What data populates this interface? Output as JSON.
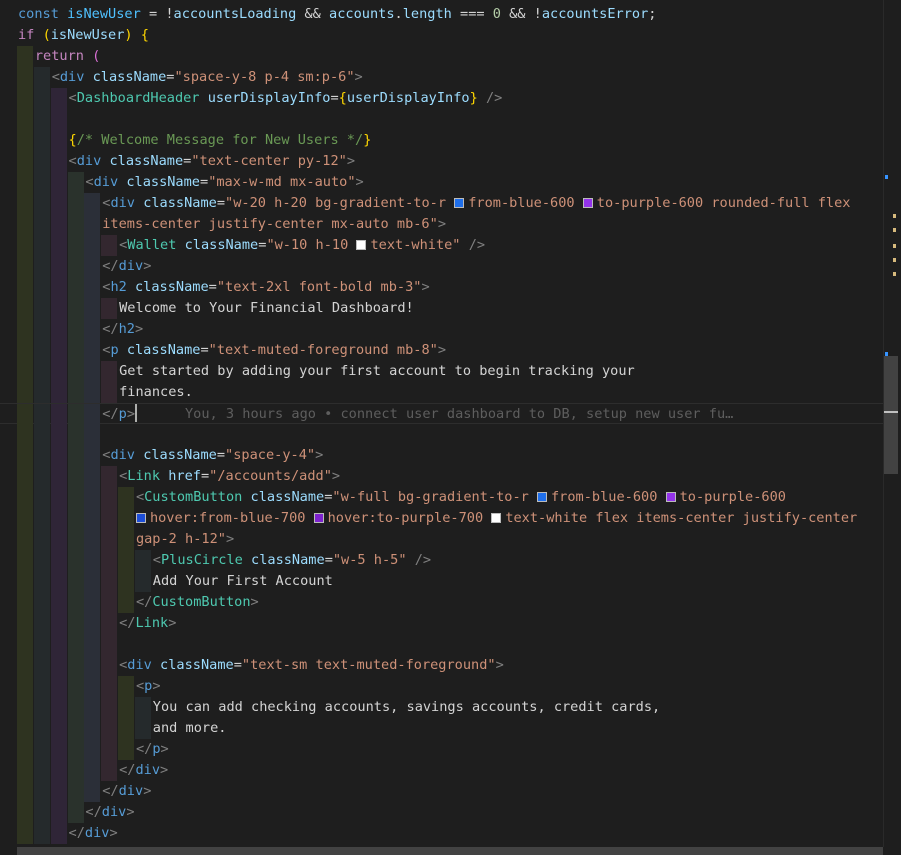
{
  "editor": {
    "blame": "You, 3 hours ago • connect user dashboard to DB, setup new user fu…",
    "lines": [
      {
        "indent": 0,
        "tokens": [
          {
            "c": "sk",
            "t": "const "
          },
          {
            "c": "cn",
            "t": "isNewUser"
          },
          {
            "c": "op",
            "t": " = !"
          },
          {
            "c": "vr",
            "t": "accountsLoading"
          },
          {
            "c": "op",
            "t": " && "
          },
          {
            "c": "vr",
            "t": "accounts"
          },
          {
            "c": "op",
            "t": "."
          },
          {
            "c": "vr",
            "t": "length"
          },
          {
            "c": "op",
            "t": " === "
          },
          {
            "c": "nm",
            "t": "0"
          },
          {
            "c": "op",
            "t": " && !"
          },
          {
            "c": "vr",
            "t": "accountsError"
          },
          {
            "c": "op",
            "t": ";"
          }
        ]
      },
      {
        "indent": 0,
        "tokens": [
          {
            "c": "kw",
            "t": "if "
          },
          {
            "c": "br1",
            "t": "("
          },
          {
            "c": "vr",
            "t": "isNewUser"
          },
          {
            "c": "br1",
            "t": ")"
          },
          {
            "c": "op",
            "t": " "
          },
          {
            "c": "br1",
            "t": "{"
          }
        ]
      },
      {
        "indent": 1,
        "tokens": [
          {
            "c": "kw",
            "t": "return "
          },
          {
            "c": "br2",
            "t": "("
          }
        ]
      },
      {
        "indent": 2,
        "tokens": [
          {
            "c": "pn",
            "t": "<"
          },
          {
            "c": "tg",
            "t": "div"
          },
          {
            "c": "op",
            "t": " "
          },
          {
            "c": "at",
            "t": "className"
          },
          {
            "c": "op",
            "t": "="
          },
          {
            "c": "st",
            "t": "\"space-y-8 p-4 sm:p-6\""
          },
          {
            "c": "pn",
            "t": ">"
          }
        ]
      },
      {
        "indent": 3,
        "tokens": [
          {
            "c": "pn",
            "t": "<"
          },
          {
            "c": "cp",
            "t": "DashboardHeader"
          },
          {
            "c": "op",
            "t": " "
          },
          {
            "c": "at",
            "t": "userDisplayInfo"
          },
          {
            "c": "op",
            "t": "="
          },
          {
            "c": "br1",
            "t": "{"
          },
          {
            "c": "vr",
            "t": "userDisplayInfo"
          },
          {
            "c": "br1",
            "t": "}"
          },
          {
            "c": "op",
            "t": " "
          },
          {
            "c": "pn",
            "t": "/>"
          }
        ]
      },
      {
        "indent": 3,
        "tokens": []
      },
      {
        "indent": 3,
        "tokens": [
          {
            "c": "br1",
            "t": "{"
          },
          {
            "c": "cm",
            "t": "/* Welcome Message for New Users */"
          },
          {
            "c": "br1",
            "t": "}"
          }
        ]
      },
      {
        "indent": 3,
        "tokens": [
          {
            "c": "pn",
            "t": "<"
          },
          {
            "c": "tg",
            "t": "div"
          },
          {
            "c": "op",
            "t": " "
          },
          {
            "c": "at",
            "t": "className"
          },
          {
            "c": "op",
            "t": "="
          },
          {
            "c": "st",
            "t": "\"text-center py-12\""
          },
          {
            "c": "pn",
            "t": ">"
          }
        ]
      },
      {
        "indent": 4,
        "tokens": [
          {
            "c": "pn",
            "t": "<"
          },
          {
            "c": "tg",
            "t": "div"
          },
          {
            "c": "op",
            "t": " "
          },
          {
            "c": "at",
            "t": "className"
          },
          {
            "c": "op",
            "t": "="
          },
          {
            "c": "st",
            "t": "\"max-w-md mx-auto\""
          },
          {
            "c": "pn",
            "t": ">"
          }
        ]
      },
      {
        "indent": 5,
        "tokens": [
          {
            "c": "pn",
            "t": "<"
          },
          {
            "c": "tg",
            "t": "div"
          },
          {
            "c": "op",
            "t": " "
          },
          {
            "c": "at",
            "t": "className"
          },
          {
            "c": "op",
            "t": "="
          },
          {
            "c": "st",
            "t": "\"w-20 h-20 bg-gradient-to-r "
          },
          {
            "sw": "#1f6feb"
          },
          {
            "c": "st",
            "t": "from-blue-600 "
          },
          {
            "sw": "#9333ea"
          },
          {
            "c": "st",
            "t": "to-purple-600 rounded-full flex"
          }
        ]
      },
      {
        "indent": 5,
        "tokens": [
          {
            "c": "st",
            "t": "items-center justify-center mx-auto mb-6\""
          },
          {
            "c": "pn",
            "t": ">"
          }
        ]
      },
      {
        "indent": 6,
        "tokens": [
          {
            "c": "pn",
            "t": "<"
          },
          {
            "c": "cp",
            "t": "Wallet"
          },
          {
            "c": "op",
            "t": " "
          },
          {
            "c": "at",
            "t": "className"
          },
          {
            "c": "op",
            "t": "="
          },
          {
            "c": "st",
            "t": "\"w-10 h-10 "
          },
          {
            "sw": "#ffffff"
          },
          {
            "c": "st",
            "t": "text-white\""
          },
          {
            "c": "op",
            "t": " "
          },
          {
            "c": "pn",
            "t": "/>"
          }
        ]
      },
      {
        "indent": 5,
        "tokens": [
          {
            "c": "pn",
            "t": "</"
          },
          {
            "c": "tg",
            "t": "div"
          },
          {
            "c": "pn",
            "t": ">"
          }
        ]
      },
      {
        "indent": 5,
        "tokens": [
          {
            "c": "pn",
            "t": "<"
          },
          {
            "c": "tg",
            "t": "h2"
          },
          {
            "c": "op",
            "t": " "
          },
          {
            "c": "at",
            "t": "className"
          },
          {
            "c": "op",
            "t": "="
          },
          {
            "c": "st",
            "t": "\"text-2xl font-bold mb-3\""
          },
          {
            "c": "pn",
            "t": ">"
          }
        ]
      },
      {
        "indent": 6,
        "tokens": [
          {
            "c": "tx",
            "t": "Welcome to Your Financial Dashboard!"
          }
        ]
      },
      {
        "indent": 5,
        "tokens": [
          {
            "c": "pn",
            "t": "</"
          },
          {
            "c": "tg",
            "t": "h2"
          },
          {
            "c": "pn",
            "t": ">"
          }
        ]
      },
      {
        "indent": 5,
        "tokens": [
          {
            "c": "pn",
            "t": "<"
          },
          {
            "c": "tg",
            "t": "p"
          },
          {
            "c": "op",
            "t": " "
          },
          {
            "c": "at",
            "t": "className"
          },
          {
            "c": "op",
            "t": "="
          },
          {
            "c": "st",
            "t": "\"text-muted-foreground mb-8\""
          },
          {
            "c": "pn",
            "t": ">"
          }
        ]
      },
      {
        "indent": 6,
        "tokens": [
          {
            "c": "tx",
            "t": "Get started by adding your first account to begin tracking your"
          }
        ]
      },
      {
        "indent": 6,
        "tokens": [
          {
            "c": "tx",
            "t": "finances."
          }
        ]
      },
      {
        "indent": 5,
        "active": true,
        "tokens": [
          {
            "c": "pn",
            "t": "</"
          },
          {
            "c": "tg",
            "t": "p"
          },
          {
            "c": "pn",
            "t": ">"
          }
        ]
      },
      {
        "indent": 5,
        "tokens": []
      },
      {
        "indent": 5,
        "tokens": [
          {
            "c": "pn",
            "t": "<"
          },
          {
            "c": "tg",
            "t": "div"
          },
          {
            "c": "op",
            "t": " "
          },
          {
            "c": "at",
            "t": "className"
          },
          {
            "c": "op",
            "t": "="
          },
          {
            "c": "st",
            "t": "\"space-y-4\""
          },
          {
            "c": "pn",
            "t": ">"
          }
        ]
      },
      {
        "indent": 6,
        "tokens": [
          {
            "c": "pn",
            "t": "<"
          },
          {
            "c": "cp",
            "t": "Link"
          },
          {
            "c": "op",
            "t": " "
          },
          {
            "c": "at",
            "t": "href"
          },
          {
            "c": "op",
            "t": "="
          },
          {
            "c": "st",
            "t": "\"/accounts/add\""
          },
          {
            "c": "pn",
            "t": ">"
          }
        ]
      },
      {
        "indent": 7,
        "tokens": [
          {
            "c": "pn",
            "t": "<"
          },
          {
            "c": "cp",
            "t": "CustomButton"
          },
          {
            "c": "op",
            "t": " "
          },
          {
            "c": "at",
            "t": "className"
          },
          {
            "c": "op",
            "t": "="
          },
          {
            "c": "st",
            "t": "\"w-full bg-gradient-to-r "
          },
          {
            "sw": "#1f6feb"
          },
          {
            "c": "st",
            "t": "from-blue-600 "
          },
          {
            "sw": "#9333ea"
          },
          {
            "c": "st",
            "t": "to-purple-600"
          }
        ]
      },
      {
        "indent": 7,
        "tokens": [
          {
            "sw": "#1d4ed8"
          },
          {
            "c": "st",
            "t": "hover:from-blue-700 "
          },
          {
            "sw": "#7e22ce"
          },
          {
            "c": "st",
            "t": "hover:to-purple-700 "
          },
          {
            "sw": "#ffffff"
          },
          {
            "c": "st",
            "t": "text-white flex items-center justify-center"
          }
        ]
      },
      {
        "indent": 7,
        "tokens": [
          {
            "c": "st",
            "t": "gap-2 h-12\""
          },
          {
            "c": "pn",
            "t": ">"
          }
        ]
      },
      {
        "indent": 8,
        "tokens": [
          {
            "c": "pn",
            "t": "<"
          },
          {
            "c": "cp",
            "t": "PlusCircle"
          },
          {
            "c": "op",
            "t": " "
          },
          {
            "c": "at",
            "t": "className"
          },
          {
            "c": "op",
            "t": "="
          },
          {
            "c": "st",
            "t": "\"w-5 h-5\""
          },
          {
            "c": "op",
            "t": " "
          },
          {
            "c": "pn",
            "t": "/>"
          }
        ]
      },
      {
        "indent": 8,
        "tokens": [
          {
            "c": "tx",
            "t": "Add Your First Account"
          }
        ]
      },
      {
        "indent": 7,
        "tokens": [
          {
            "c": "pn",
            "t": "</"
          },
          {
            "c": "cp",
            "t": "CustomButton"
          },
          {
            "c": "pn",
            "t": ">"
          }
        ]
      },
      {
        "indent": 6,
        "tokens": [
          {
            "c": "pn",
            "t": "</"
          },
          {
            "c": "cp",
            "t": "Link"
          },
          {
            "c": "pn",
            "t": ">"
          }
        ]
      },
      {
        "indent": 6,
        "tokens": []
      },
      {
        "indent": 6,
        "tokens": [
          {
            "c": "pn",
            "t": "<"
          },
          {
            "c": "tg",
            "t": "div"
          },
          {
            "c": "op",
            "t": " "
          },
          {
            "c": "at",
            "t": "className"
          },
          {
            "c": "op",
            "t": "="
          },
          {
            "c": "st",
            "t": "\"text-sm text-muted-foreground\""
          },
          {
            "c": "pn",
            "t": ">"
          }
        ]
      },
      {
        "indent": 7,
        "tokens": [
          {
            "c": "pn",
            "t": "<"
          },
          {
            "c": "tg",
            "t": "p"
          },
          {
            "c": "pn",
            "t": ">"
          }
        ]
      },
      {
        "indent": 8,
        "tokens": [
          {
            "c": "tx",
            "t": "You can add checking accounts, savings accounts, credit cards,"
          }
        ]
      },
      {
        "indent": 8,
        "tokens": [
          {
            "c": "tx",
            "t": "and more."
          }
        ]
      },
      {
        "indent": 7,
        "tokens": [
          {
            "c": "pn",
            "t": "</"
          },
          {
            "c": "tg",
            "t": "p"
          },
          {
            "c": "pn",
            "t": ">"
          }
        ]
      },
      {
        "indent": 6,
        "tokens": [
          {
            "c": "pn",
            "t": "</"
          },
          {
            "c": "tg",
            "t": "div"
          },
          {
            "c": "pn",
            "t": ">"
          }
        ]
      },
      {
        "indent": 5,
        "tokens": [
          {
            "c": "pn",
            "t": "</"
          },
          {
            "c": "tg",
            "t": "div"
          },
          {
            "c": "pn",
            "t": ">"
          }
        ]
      },
      {
        "indent": 4,
        "tokens": [
          {
            "c": "pn",
            "t": "</"
          },
          {
            "c": "tg",
            "t": "div"
          },
          {
            "c": "pn",
            "t": ">"
          }
        ]
      },
      {
        "indent": 3,
        "tokens": [
          {
            "c": "pn",
            "t": "</"
          },
          {
            "c": "tg",
            "t": "div"
          },
          {
            "c": "pn",
            "t": ">"
          }
        ]
      }
    ]
  }
}
